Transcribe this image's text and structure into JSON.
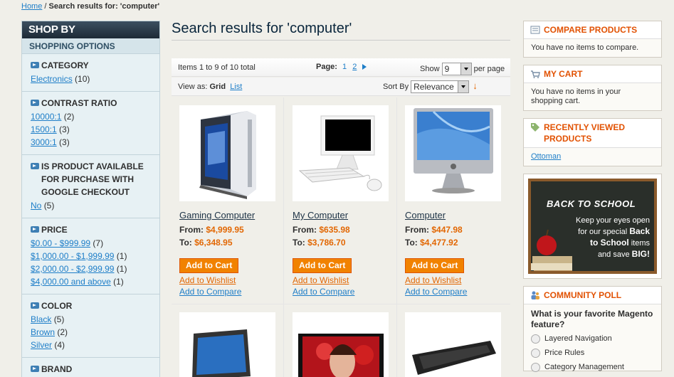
{
  "breadcrumb": {
    "home": "Home",
    "separator": "/",
    "current": "Search results for: 'computer'"
  },
  "sidebar": {
    "title": "SHOP BY",
    "subtitle": "SHOPPING OPTIONS",
    "filters": [
      {
        "title": "CATEGORY",
        "options": [
          {
            "label": "Electronics",
            "count": "(10)"
          }
        ]
      },
      {
        "title": "CONTRAST RATIO",
        "options": [
          {
            "label": "10000:1",
            "count": "(2)"
          },
          {
            "label": "1500:1",
            "count": "(3)"
          },
          {
            "label": "3000:1",
            "count": "(3)"
          }
        ]
      },
      {
        "title": "IS PRODUCT AVAILABLE FOR PURCHASE WITH GOOGLE CHECKOUT",
        "options": [
          {
            "label": "No",
            "count": "(5)"
          }
        ]
      },
      {
        "title": "PRICE",
        "options": [
          {
            "label": "$0.00 - $999.99",
            "count": "(7)"
          },
          {
            "label": "$1,000.00 - $1,999.99",
            "count": "(1)"
          },
          {
            "label": "$2,000.00 - $2,999.99",
            "count": "(1)"
          },
          {
            "label": "$4,000.00 and above",
            "count": "(1)"
          }
        ]
      },
      {
        "title": "COLOR",
        "options": [
          {
            "label": "Black",
            "count": "(5)"
          },
          {
            "label": "Brown",
            "count": "(2)"
          },
          {
            "label": "Silver",
            "count": "(4)"
          }
        ]
      },
      {
        "title": "BRAND",
        "options": []
      }
    ]
  },
  "main": {
    "title": "Search results for 'computer'",
    "toolbar": {
      "items": "Items 1 to 9 of 10 total",
      "page_label": "Page:",
      "page_current": "1",
      "page_next": "2",
      "show_label": "Show",
      "show_value": "9",
      "per_page": "per page",
      "view_as": "View as:",
      "view_grid": "Grid",
      "view_list": "List",
      "sort_by": "Sort By",
      "sort_value": "Relevance",
      "sort_dir": "↓"
    },
    "products": [
      {
        "name": "Gaming Computer",
        "from_label": "From:",
        "from": "$4,999.95",
        "to_label": "To:",
        "to": "$6,348.95",
        "cart": "Add to Cart",
        "wishlist": "Add to Wishlist",
        "compare": "Add to Compare"
      },
      {
        "name": "My Computer",
        "from_label": "From:",
        "from": "$635.98",
        "to_label": "To:",
        "to": "$3,786.70",
        "cart": "Add to Cart",
        "wishlist": "Add to Wishlist",
        "compare": "Add to Compare"
      },
      {
        "name": "Computer",
        "from_label": "From:",
        "from": "$447.98",
        "to_label": "To:",
        "to": "$4,477.92",
        "cart": "Add to Cart",
        "wishlist": "Add to Wishlist",
        "compare": "Add to Compare"
      }
    ]
  },
  "right": {
    "compare": {
      "title": "COMPARE PRODUCTS",
      "text": "You have no items to compare."
    },
    "cart": {
      "title": "MY CART",
      "text": "You have no items in your shopping cart."
    },
    "recent": {
      "title": "RECENTLY VIEWED PRODUCTS",
      "item": "Ottoman"
    },
    "promo": {
      "headline": "BACK TO SCHOOL",
      "line1": "Keep your eyes open",
      "line2": "for our special",
      "bold1": "Back",
      "line3": "to School",
      "line3b": "items",
      "line4": "and save",
      "bold2": "BIG!"
    },
    "poll": {
      "title": "COMMUNITY POLL",
      "question": "What is your favorite Magento feature?",
      "options": [
        "Layered Navigation",
        "Price Rules",
        "Category Management"
      ]
    }
  },
  "colors": {
    "accent": "#e26703",
    "link": "#1e7ec8",
    "button": "#f18200",
    "sidebar_bg": "#e7f1f4"
  }
}
